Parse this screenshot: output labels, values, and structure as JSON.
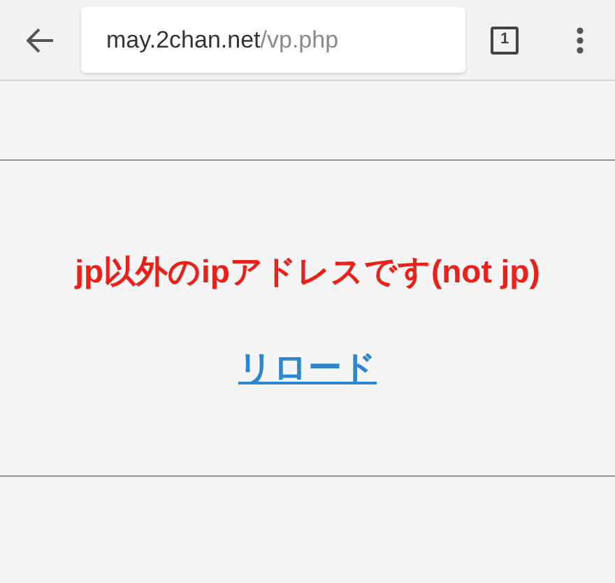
{
  "toolbar": {
    "url_host": "may.2chan.net",
    "url_path": "/vp.php",
    "tab_count": "1"
  },
  "page": {
    "message": "jp以外のipアドレスです(not jp)",
    "link": "リロード"
  }
}
